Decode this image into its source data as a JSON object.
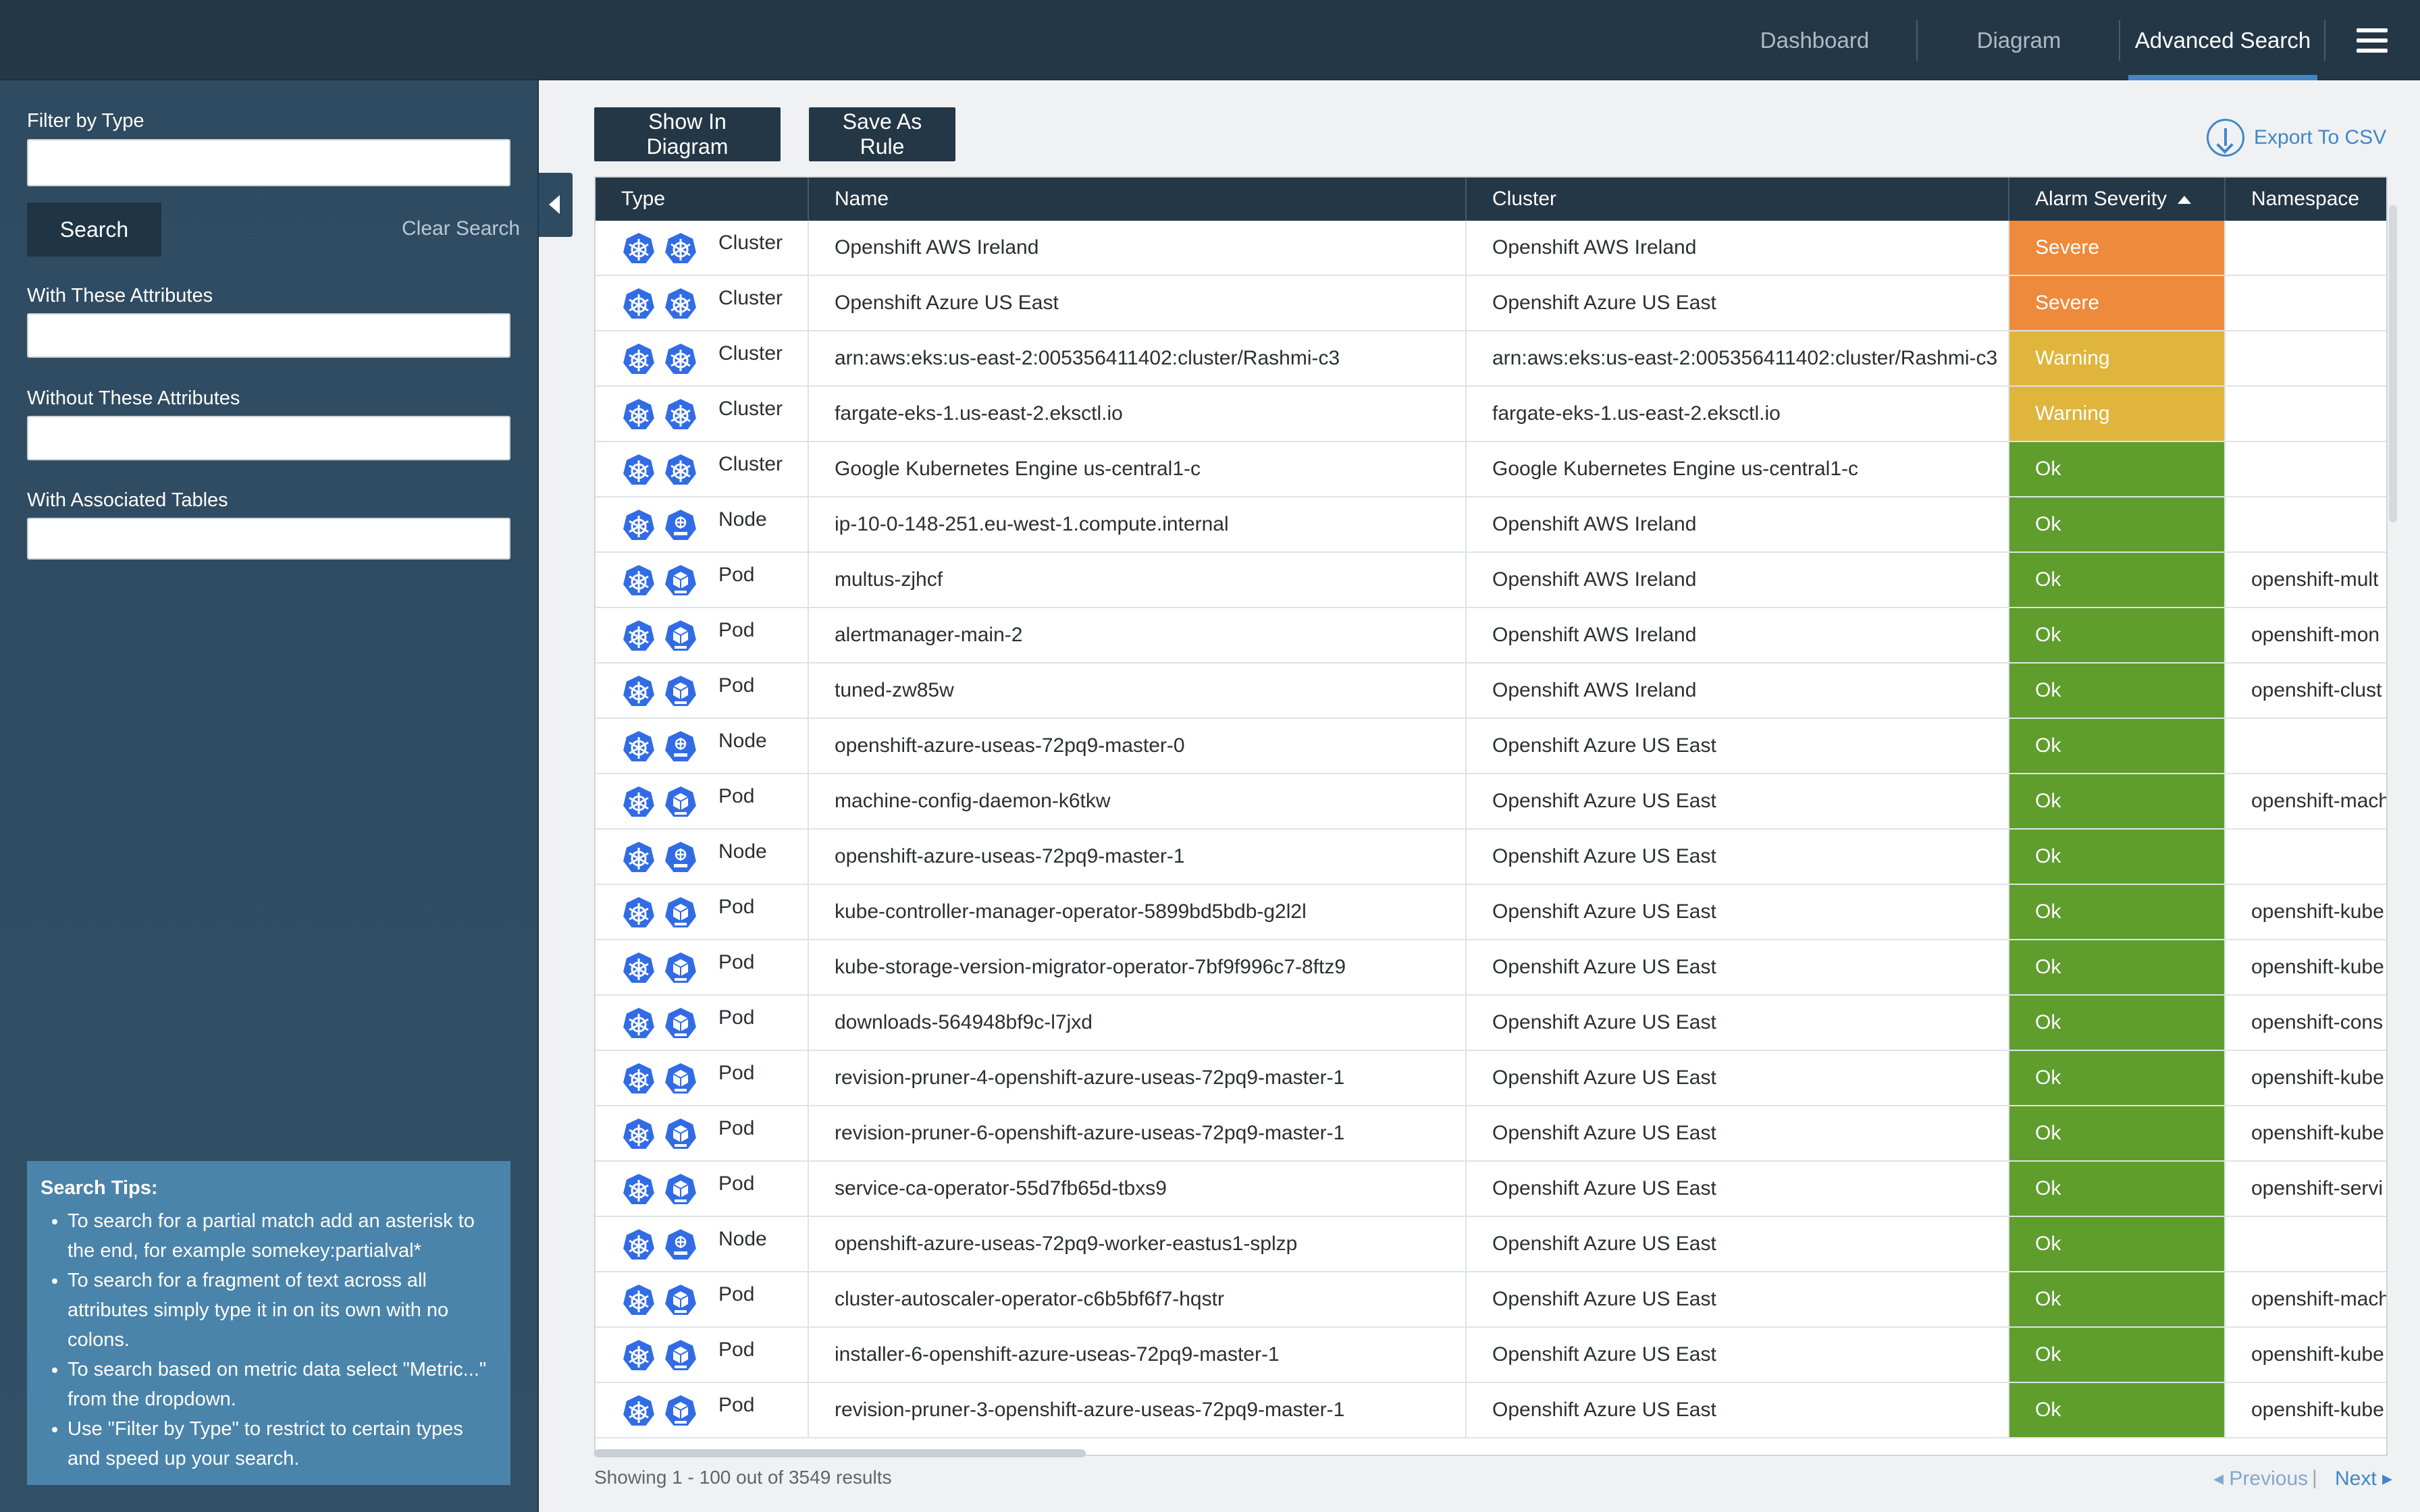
{
  "nav": {
    "tabs": [
      {
        "label": "Dashboard",
        "active": false
      },
      {
        "label": "Diagram",
        "active": false
      },
      {
        "label": "Advanced Search",
        "active": true
      }
    ],
    "menu_icon": "hamburger-menu-icon"
  },
  "sidebar": {
    "filter_type_label": "Filter by Type",
    "filter_type_value": "",
    "search_label": "Search",
    "clear_label": "Clear Search",
    "with_attributes_label": "With These Attributes",
    "with_attributes_value": "",
    "without_attributes_label": "Without These Attributes",
    "without_attributes_value": "",
    "associated_tables_label": "With Associated Tables",
    "associated_tables_value": "",
    "tips_title": "Search Tips:",
    "tips": [
      "To search for a partial match add an asterisk to the end, for example somekey:partialval*",
      "To search for a fragment of text across all attributes simply type it in on its own with no colons.",
      "To search based on metric data select \"Metric...\" from the dropdown.",
      "Use \"Filter by Type\" to restrict to certain types and speed up your search."
    ]
  },
  "toolbar": {
    "show_in_diagram": "Show In Diagram",
    "save_as_rule": "Save As Rule",
    "export_csv": "Export To CSV"
  },
  "table": {
    "columns": [
      "Type",
      "Name",
      "Cluster",
      "Alarm Severity",
      "Namespace"
    ],
    "sort_column": "Alarm Severity",
    "sort_direction": "ascending",
    "rows": [
      {
        "type": "Cluster",
        "name": "Openshift AWS Ireland",
        "cluster": "Openshift AWS Ireland",
        "severity": "Severe",
        "namespace": ""
      },
      {
        "type": "Cluster",
        "name": "Openshift Azure US East",
        "cluster": "Openshift Azure US East",
        "severity": "Severe",
        "namespace": ""
      },
      {
        "type": "Cluster",
        "name": "arn:aws:eks:us-east-2:005356411402:cluster/Rashmi-c3",
        "cluster": "arn:aws:eks:us-east-2:005356411402:cluster/Rashmi-c3",
        "severity": "Warning",
        "namespace": ""
      },
      {
        "type": "Cluster",
        "name": "fargate-eks-1.us-east-2.eksctl.io",
        "cluster": "fargate-eks-1.us-east-2.eksctl.io",
        "severity": "Warning",
        "namespace": ""
      },
      {
        "type": "Cluster",
        "name": "Google Kubernetes Engine us-central1-c",
        "cluster": "Google Kubernetes Engine us-central1-c",
        "severity": "Ok",
        "namespace": ""
      },
      {
        "type": "Node",
        "name": "ip-10-0-148-251.eu-west-1.compute.internal",
        "cluster": "Openshift AWS Ireland",
        "severity": "Ok",
        "namespace": ""
      },
      {
        "type": "Pod",
        "name": "multus-zjhcf",
        "cluster": "Openshift AWS Ireland",
        "severity": "Ok",
        "namespace": "openshift-mult"
      },
      {
        "type": "Pod",
        "name": "alertmanager-main-2",
        "cluster": "Openshift AWS Ireland",
        "severity": "Ok",
        "namespace": "openshift-mon"
      },
      {
        "type": "Pod",
        "name": "tuned-zw85w",
        "cluster": "Openshift AWS Ireland",
        "severity": "Ok",
        "namespace": "openshift-clust"
      },
      {
        "type": "Node",
        "name": "openshift-azure-useas-72pq9-master-0",
        "cluster": "Openshift Azure US East",
        "severity": "Ok",
        "namespace": ""
      },
      {
        "type": "Pod",
        "name": "machine-config-daemon-k6tkw",
        "cluster": "Openshift Azure US East",
        "severity": "Ok",
        "namespace": "openshift-mach"
      },
      {
        "type": "Node",
        "name": "openshift-azure-useas-72pq9-master-1",
        "cluster": "Openshift Azure US East",
        "severity": "Ok",
        "namespace": ""
      },
      {
        "type": "Pod",
        "name": "kube-controller-manager-operator-5899bd5bdb-g2l2l",
        "cluster": "Openshift Azure US East",
        "severity": "Ok",
        "namespace": "openshift-kube"
      },
      {
        "type": "Pod",
        "name": "kube-storage-version-migrator-operator-7bf9f996c7-8ftz9",
        "cluster": "Openshift Azure US East",
        "severity": "Ok",
        "namespace": "openshift-kube"
      },
      {
        "type": "Pod",
        "name": "downloads-564948bf9c-l7jxd",
        "cluster": "Openshift Azure US East",
        "severity": "Ok",
        "namespace": "openshift-cons"
      },
      {
        "type": "Pod",
        "name": "revision-pruner-4-openshift-azure-useas-72pq9-master-1",
        "cluster": "Openshift Azure US East",
        "severity": "Ok",
        "namespace": "openshift-kube"
      },
      {
        "type": "Pod",
        "name": "revision-pruner-6-openshift-azure-useas-72pq9-master-1",
        "cluster": "Openshift Azure US East",
        "severity": "Ok",
        "namespace": "openshift-kube"
      },
      {
        "type": "Pod",
        "name": "service-ca-operator-55d7fb65d-tbxs9",
        "cluster": "Openshift Azure US East",
        "severity": "Ok",
        "namespace": "openshift-servi"
      },
      {
        "type": "Node",
        "name": "openshift-azure-useas-72pq9-worker-eastus1-splzp",
        "cluster": "Openshift Azure US East",
        "severity": "Ok",
        "namespace": ""
      },
      {
        "type": "Pod",
        "name": "cluster-autoscaler-operator-c6b5bf6f7-hqstr",
        "cluster": "Openshift Azure US East",
        "severity": "Ok",
        "namespace": "openshift-mach"
      },
      {
        "type": "Pod",
        "name": "installer-6-openshift-azure-useas-72pq9-master-1",
        "cluster": "Openshift Azure US East",
        "severity": "Ok",
        "namespace": "openshift-kube"
      },
      {
        "type": "Pod",
        "name": "revision-pruner-3-openshift-azure-useas-72pq9-master-1",
        "cluster": "Openshift Azure US East",
        "severity": "Ok",
        "namespace": "openshift-kube"
      }
    ]
  },
  "severity_colors": {
    "Severe": "#ee8a3c",
    "Warning": "#dfb53c",
    "Ok": "#5f9d2d"
  },
  "footer": {
    "results": "Showing 1 - 100 out of 3549 results",
    "previous": "Previous",
    "next": "Next"
  }
}
